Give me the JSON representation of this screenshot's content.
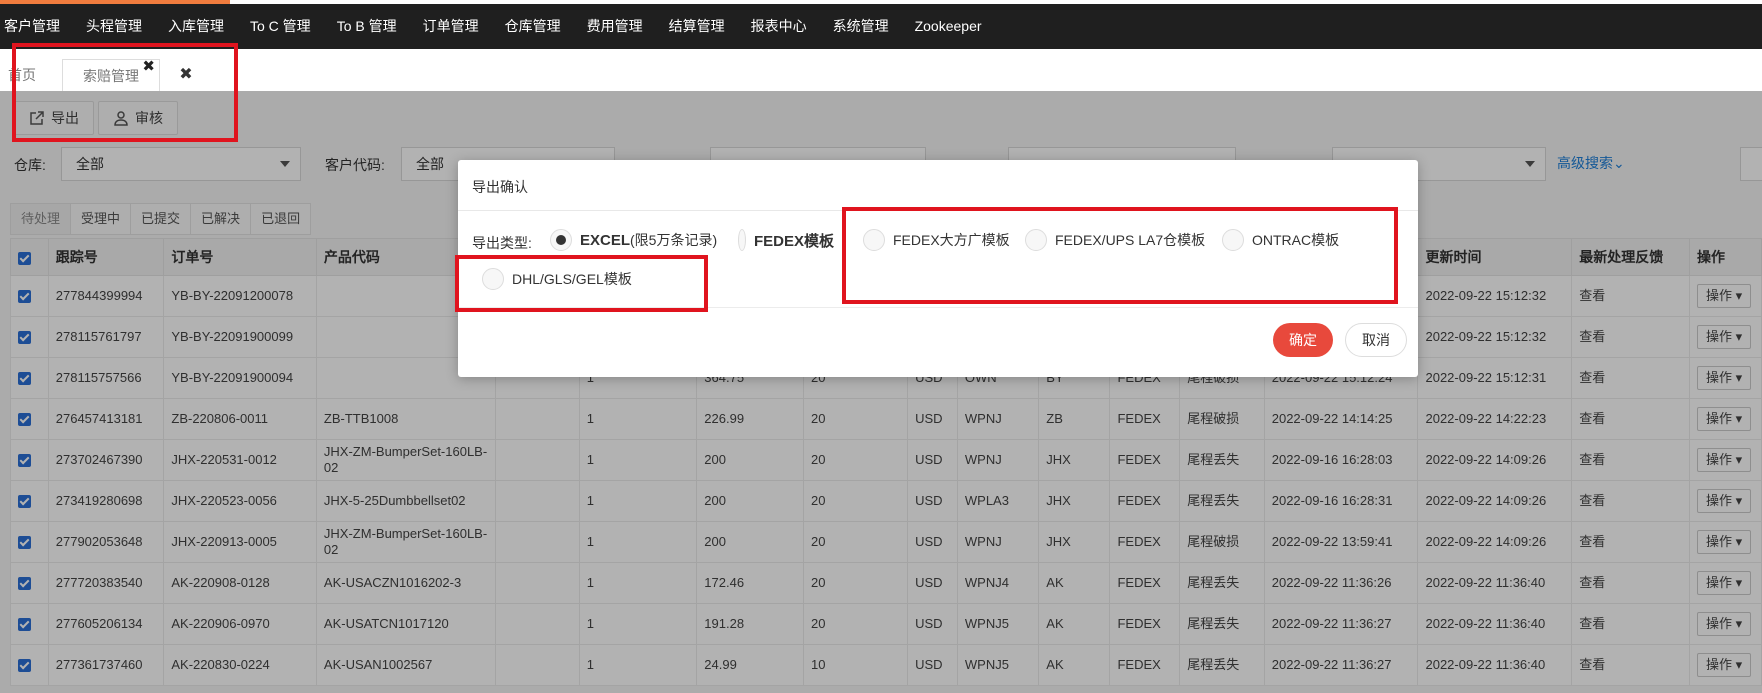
{
  "topnav": [
    "客户管理",
    "头程管理",
    "入库管理",
    "To C 管理",
    "To B 管理",
    "订单管理",
    "仓库管理",
    "费用管理",
    "结算管理",
    "报表中心",
    "系统管理",
    "Zookeeper"
  ],
  "tabs": {
    "home": "首页",
    "claim": "索赔管理",
    "close_x": "✖",
    "close_all": "✖"
  },
  "toolbar": {
    "export": "导出",
    "review": "审核"
  },
  "filters": {
    "warehouse_label": "仓库:",
    "warehouse_value": "全部",
    "customer_code_label": "客户代码:",
    "customer_code_value": "全部",
    "advanced_search": "高级搜索⌄"
  },
  "status_tabs": [
    "待处理",
    "受理中",
    "已提交",
    "已解决",
    "已退回"
  ],
  "table": {
    "headers": [
      "跟踪号",
      "订单号",
      "产品代码",
      "",
      "",
      "",
      "",
      "",
      "",
      "",
      "",
      "",
      "",
      "更新时间",
      "最新处理反馈",
      "操作"
    ],
    "rows": [
      [
        "277844399994",
        "YB-BY-22091200078",
        "",
        "",
        "",
        "",
        "",
        "",
        "",
        "",
        "",
        "",
        "",
        "2022-09-22 15:12:32",
        "查看",
        "操作"
      ],
      [
        "278115761797",
        "YB-BY-22091900099",
        "",
        "",
        "",
        "",
        "",
        "",
        "",
        "",
        "",
        "",
        "",
        "2022-09-22 15:12:32",
        "查看",
        "操作"
      ],
      [
        "278115757566",
        "YB-BY-22091900094",
        "",
        "",
        "1",
        "364.75",
        "20",
        "USD",
        "OWN",
        "BY",
        "FEDEX",
        "尾程破损",
        "2022-09-22 15:12:24",
        "2022-09-22 15:12:31",
        "查看",
        "操作"
      ],
      [
        "276457413181",
        "ZB-220806-0011",
        "ZB-TTB1008",
        "",
        "1",
        "226.99",
        "20",
        "USD",
        "WPNJ",
        "ZB",
        "FEDEX",
        "尾程破损",
        "2022-09-22 14:14:25",
        "2022-09-22 14:22:23",
        "查看",
        "操作"
      ],
      [
        "273702467390",
        "JHX-220531-0012",
        "JHX-ZM-BumperSet-160LB-02",
        "",
        "1",
        "200",
        "20",
        "USD",
        "WPNJ",
        "JHX",
        "FEDEX",
        "尾程丢失",
        "2022-09-16 16:28:03",
        "2022-09-22 14:09:26",
        "查看",
        "操作"
      ],
      [
        "273419280698",
        "JHX-220523-0056",
        "JHX-5-25Dumbbellset02",
        "",
        "1",
        "200",
        "20",
        "USD",
        "WPLA3",
        "JHX",
        "FEDEX",
        "尾程丢失",
        "2022-09-16 16:28:31",
        "2022-09-22 14:09:26",
        "查看",
        "操作"
      ],
      [
        "277902053648",
        "JHX-220913-0005",
        "JHX-ZM-BumperSet-160LB-02",
        "",
        "1",
        "200",
        "20",
        "USD",
        "WPNJ",
        "JHX",
        "FEDEX",
        "尾程破损",
        "2022-09-22 13:59:41",
        "2022-09-22 14:09:26",
        "查看",
        "操作"
      ],
      [
        "277720383540",
        "AK-220908-0128",
        "AK-USACZN1016202-3",
        "",
        "1",
        "172.46",
        "20",
        "USD",
        "WPNJ4",
        "AK",
        "FEDEX",
        "尾程丢失",
        "2022-09-22 11:36:26",
        "2022-09-22 11:36:40",
        "查看",
        "操作"
      ],
      [
        "277605206134",
        "AK-220906-0970",
        "AK-USATCN1017120",
        "",
        "1",
        "191.28",
        "20",
        "USD",
        "WPNJ5",
        "AK",
        "FEDEX",
        "尾程丢失",
        "2022-09-22 11:36:27",
        "2022-09-22 11:36:40",
        "查看",
        "操作"
      ],
      [
        "277361737460",
        "AK-220830-0224",
        "AK-USAN1002567",
        "",
        "1",
        "24.99",
        "10",
        "USD",
        "WPNJ5",
        "AK",
        "FEDEX",
        "尾程丢失",
        "2022-09-22 11:36:27",
        "2022-09-22 11:36:40",
        "查看",
        "操作"
      ]
    ]
  },
  "modal": {
    "title": "导出确认",
    "type_label": "导出类型:",
    "options": [
      {
        "main": "EXCEL",
        "sub": "(限5万条记录)",
        "selected": true
      },
      {
        "main": "FEDEX模板",
        "sub": "",
        "selected": false
      },
      {
        "main": "",
        "sub": "FEDEX大方广模板",
        "selected": false
      },
      {
        "main": "",
        "sub": "FEDEX/UPS LA7仓模板",
        "selected": false
      },
      {
        "main": "",
        "sub": "ONTRAC模板",
        "selected": false
      },
      {
        "main": "",
        "sub": "DHL/GLS/GEL模板",
        "selected": false
      }
    ],
    "ok": "确定",
    "cancel": "取消"
  },
  "colors": {
    "nav_bg": "#1f1f1f",
    "accent": "#f07c3e",
    "ok_button": "#e8493c",
    "link": "#1e7fd8",
    "highlight_box": "#e0141e"
  }
}
